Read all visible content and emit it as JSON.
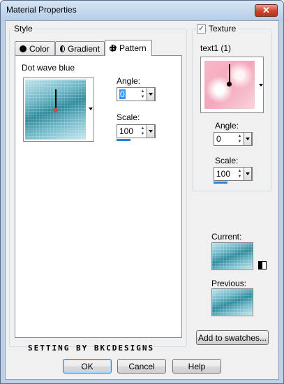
{
  "window": {
    "title": "Material Properties",
    "close_symbol": "✕"
  },
  "style_group": {
    "legend": "Style",
    "tabs": [
      {
        "label": "Color",
        "icon": "filled-circle-icon"
      },
      {
        "label": "Gradient",
        "icon": "half-circle-icon"
      },
      {
        "label": "Pattern",
        "icon": "pattern-icon"
      }
    ],
    "active_tab": "Pattern",
    "pattern_name": "Dot wave blue",
    "angle_label": "Angle:",
    "angle_value": "0",
    "scale_label": "Scale:",
    "scale_value": "100",
    "scale_fill": 0.35
  },
  "texture_group": {
    "checkbox_label": "Texture",
    "checked": true,
    "texture_name": "text1 (1)",
    "angle_label": "Angle:",
    "angle_value": "0",
    "scale_label": "Scale:",
    "scale_value": "100",
    "scale_fill": 0.35
  },
  "preview": {
    "current_label": "Current:",
    "previous_label": "Previous:",
    "add_to_swatches": "Add to swatches..."
  },
  "watermark": "SETTING BY BKCDESIGNS",
  "buttons": {
    "ok": "OK",
    "cancel": "Cancel",
    "help": "Help"
  },
  "colors": {
    "accent": "#2a7fd6",
    "teal": "#2e8a9c",
    "pink": "#f4a7bb",
    "close_red": "#c9452c"
  }
}
